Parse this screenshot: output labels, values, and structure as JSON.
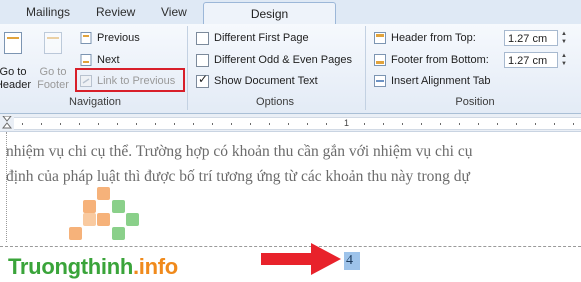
{
  "tabs": [
    "Mailings",
    "Review",
    "View",
    "Design"
  ],
  "navigation": {
    "goto_header_l1": "Go to",
    "goto_header_l2": "Header",
    "goto_footer_l1": "Go to",
    "goto_footer_l2": "Footer",
    "previous": "Previous",
    "next": "Next",
    "link_to_previous": "Link to Previous",
    "group_label": "Navigation"
  },
  "options": {
    "different_first_page": "Different First Page",
    "different_odd_even": "Different Odd & Even Pages",
    "show_document_text": "Show Document Text",
    "different_first_page_checked": false,
    "different_odd_even_checked": false,
    "show_document_text_checked": true,
    "check_glyph": "✓",
    "group_label": "Options"
  },
  "position": {
    "header_from_top_label": "Header from Top:",
    "header_from_top_value": "1.27 cm",
    "footer_from_bottom_label": "Footer from Bottom:",
    "footer_from_bottom_value": "1.27 cm",
    "insert_alignment_tab": "Insert Alignment Tab",
    "group_label": "Position"
  },
  "ruler": {
    "numbers": [
      "1"
    ]
  },
  "document": {
    "line1": "nhiệm vụ chi cụ thể. Trường hợp có khoản thu cần gắn với nhiệm vụ chi cụ",
    "line2": "định của pháp luật thì được bố trí tương ứng từ các khoản thu này trong dự",
    "page_number": "4"
  },
  "watermark": {
    "part1": "Truongthinh",
    "part2": ".info"
  },
  "colors": {
    "highlight_box": "#d81f2a",
    "arrow": "#e8222b",
    "page_number_bg": "#9dc3ea",
    "logo_green": "#3aa43a",
    "logo_orange": "#f08a1c"
  }
}
